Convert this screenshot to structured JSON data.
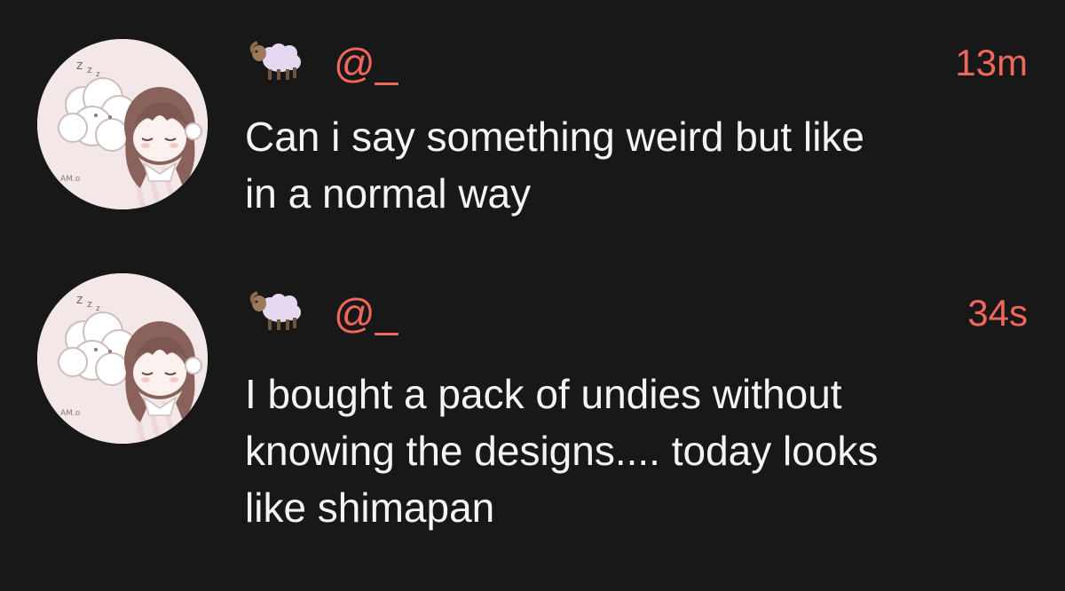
{
  "feed": {
    "posts": [
      {
        "avatar_icon": "sleeping-girl-and-sheep-avatar",
        "badge_icon": "sheep-emoji-icon",
        "handle": "@_",
        "time": "13m",
        "text": "Can i say something weird but like\nin a normal way"
      },
      {
        "avatar_icon": "sleeping-girl-and-sheep-avatar",
        "badge_icon": "sheep-emoji-icon",
        "handle": "@_",
        "time": "34s",
        "text": "I bought a pack of undies without\nknowing the designs.... today looks\nlike shimapan"
      }
    ]
  },
  "colors": {
    "background": "#181818",
    "accent": "#f0675c",
    "text": "#f4f4f4"
  }
}
